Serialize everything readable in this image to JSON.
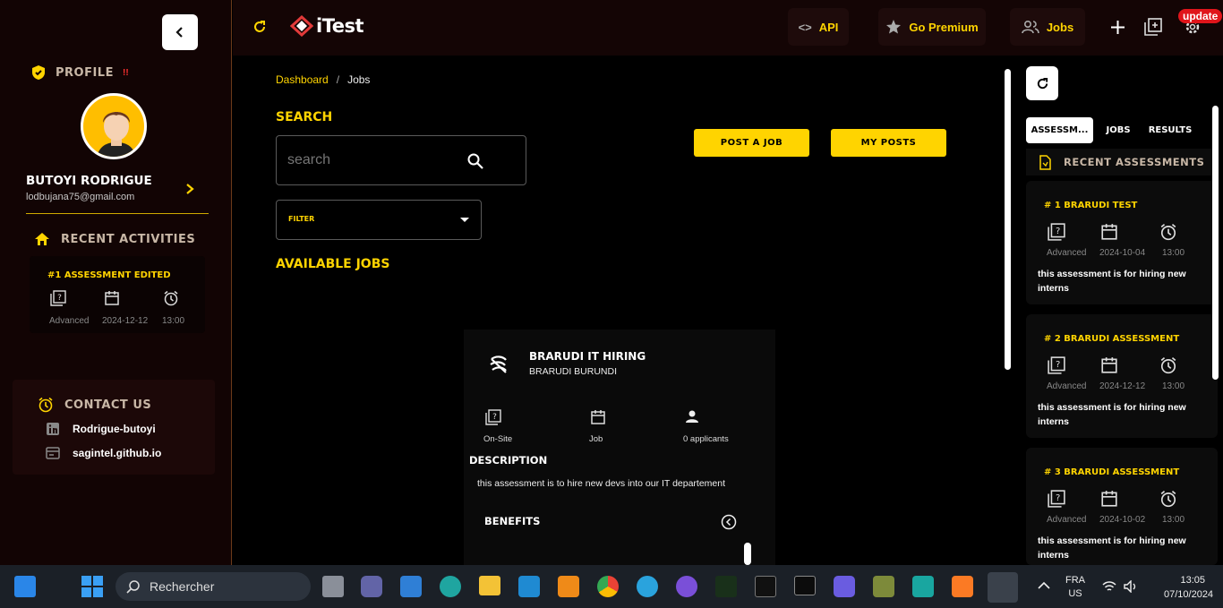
{
  "profile": {
    "label": "PROFILE",
    "badge": "!!",
    "name": "BUTOYI RODRIGUE",
    "email": "lodbujana75@gmail.com"
  },
  "recent": {
    "label": "RECENT ACTIVITIES",
    "item_title": "#1 ASSESSMENT EDITED",
    "level": "Advanced",
    "date": "2024-12-12",
    "time": "13:00"
  },
  "contact": {
    "label": "CONTACT US",
    "linkedin": "Rodrigue-butoyi",
    "site": "sagintel.github.io"
  },
  "topbar": {
    "brand": "iTest",
    "api": "API",
    "premium": "Go Premium",
    "jobs": "Jobs",
    "update": "update"
  },
  "breadcrumb": {
    "root": "Dashboard",
    "sep": "/",
    "current": "Jobs"
  },
  "search": {
    "title": "SEARCH",
    "placeholder": "search"
  },
  "buttons": {
    "post": "POST A JOB",
    "posts": "MY POSTS"
  },
  "filter": {
    "label": "FILTER"
  },
  "available": "AVAILABLE JOBS",
  "job": {
    "title": "BRARUDI IT HIRING",
    "company": "BRARUDI BURUNDI",
    "type": "On-Site",
    "kind": "Job",
    "applicants": "0 applicants",
    "desc_label": "DESCRIPTION",
    "desc": "this assessment is to hire new devs into our IT departement",
    "benefits": "BENEFITS"
  },
  "right": {
    "tabs": [
      "ASSESSM...",
      "JOBS",
      "RESULTS"
    ],
    "recent_label": "RECENT ASSESSMENTS",
    "cards": [
      {
        "title": "# 1 BRARUDI TEST",
        "level": "Advanced",
        "date": "2024-10-04",
        "time": "13:00",
        "desc": "this assessment is for hiring new interns"
      },
      {
        "title": "# 2 BRARUDI ASSESSMENT",
        "level": "Advanced",
        "date": "2024-12-12",
        "time": "13:00",
        "desc": "this assessment is for hiring new interns"
      },
      {
        "title": "# 3 BRARUDI ASSESSMENT",
        "level": "Advanced",
        "date": "2024-10-02",
        "time": "13:00",
        "desc": "this assessment is for hiring new interns"
      }
    ]
  },
  "taskbar": {
    "search": "Rechercher",
    "lang1": "FRA",
    "lang2": "US",
    "time": "13:05",
    "date": "07/10/2024"
  },
  "colors": {
    "accent": "#ffd400",
    "bg": "#000000",
    "panel": "#1c0808"
  }
}
